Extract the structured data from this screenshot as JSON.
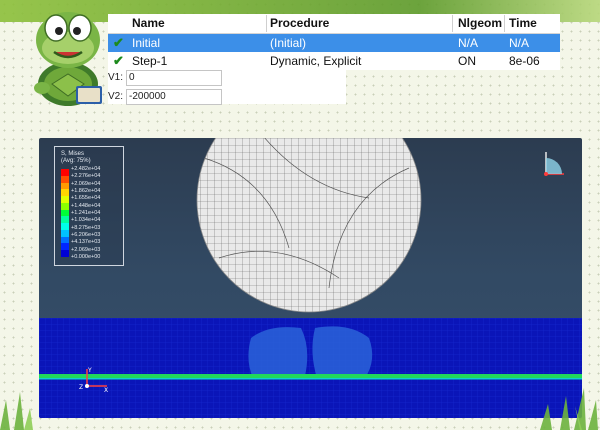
{
  "table": {
    "headers": {
      "name": "Name",
      "procedure": "Procedure",
      "nlgeom": "Nlgeom",
      "time": "Time"
    },
    "rows": [
      {
        "name": "Initial",
        "procedure": "(Initial)",
        "nlgeom": "N/A",
        "time": "N/A",
        "selected": true
      },
      {
        "name": "Step-1",
        "procedure": "Dynamic, Explicit",
        "nlgeom": "ON",
        "time": "8e-06",
        "selected": false
      }
    ]
  },
  "fields": {
    "v1": {
      "label": "V1:",
      "value": "0"
    },
    "v2": {
      "label": "V2:",
      "value": "-200000"
    }
  },
  "legend": {
    "title_line1": "S, Mises",
    "title_line2": "(Avg: 75%)",
    "values": [
      "+2.482e+04",
      "+2.276e+04",
      "+2.069e+04",
      "+1.862e+04",
      "+1.655e+04",
      "+1.448e+04",
      "+1.241e+04",
      "+1.034e+04",
      "+8.275e+03",
      "+6.206e+03",
      "+4.137e+03",
      "+2.069e+03",
      "+0.000e+00"
    ],
    "colors": [
      "#ff0000",
      "#ff4d00",
      "#ff9a00",
      "#ffd400",
      "#e1ff00",
      "#8cff00",
      "#00ff37",
      "#00ff9e",
      "#00ffea",
      "#00c2ff",
      "#0070ff",
      "#0025ff",
      "#0000d6"
    ]
  },
  "triad": {
    "y": "Y",
    "z": "Z",
    "x": "X"
  }
}
